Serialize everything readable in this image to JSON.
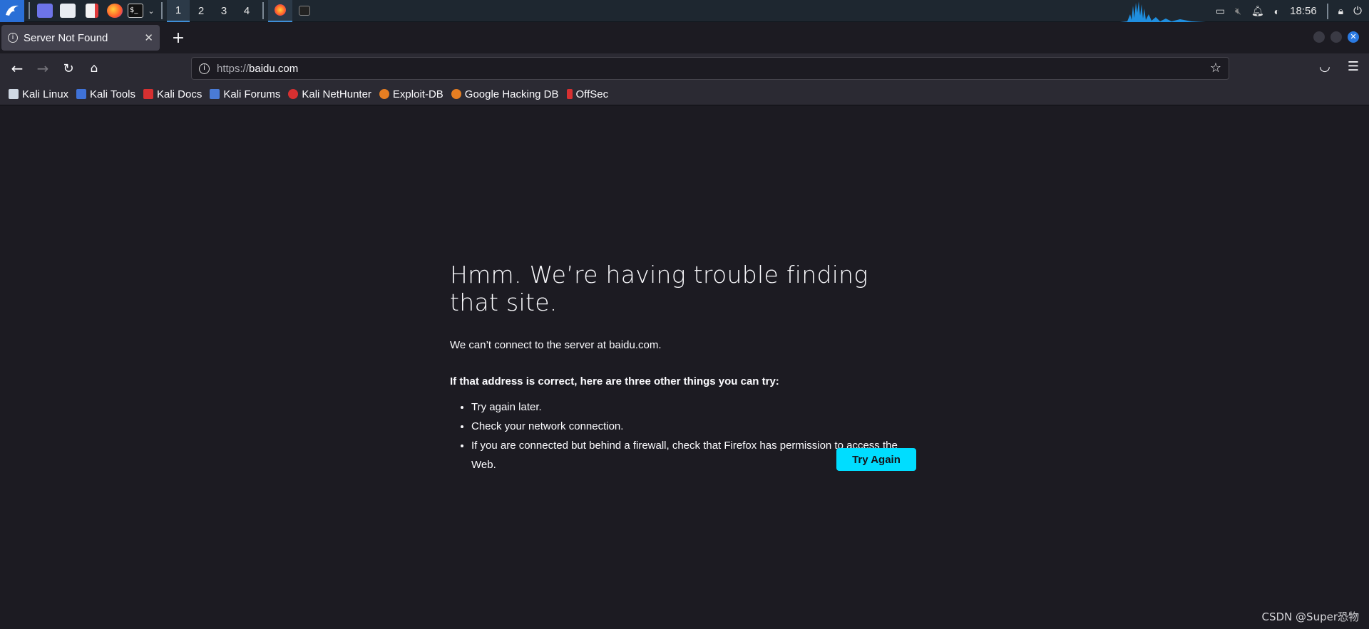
{
  "taskbar": {
    "workspaces": [
      "1",
      "2",
      "3",
      "4"
    ],
    "active_workspace": "1",
    "clock": "18:56"
  },
  "browser": {
    "tab_title": "Server Not Found",
    "url_scheme": "https://",
    "url_host": "baidu.com"
  },
  "bookmarks": [
    {
      "label": "Kali Linux",
      "icon": "kali-dragon-icon",
      "color": "#cfd8e3"
    },
    {
      "label": "Kali Tools",
      "icon": "kali-tools-icon",
      "color": "#3f72d8"
    },
    {
      "label": "Kali Docs",
      "icon": "kali-docs-icon",
      "color": "#d63031"
    },
    {
      "label": "Kali Forums",
      "icon": "kali-forums-icon",
      "color": "#4a7bd6"
    },
    {
      "label": "Kali NetHunter",
      "icon": "nethunter-icon",
      "color": "#d63031"
    },
    {
      "label": "Exploit-DB",
      "icon": "exploit-db-icon",
      "color": "#e67e22"
    },
    {
      "label": "Google Hacking DB",
      "icon": "ghdb-icon",
      "color": "#e67e22"
    },
    {
      "label": "OffSec",
      "icon": "offsec-icon",
      "color": "#d63031"
    }
  ],
  "error": {
    "heading": "Hmm. We’re having trouble finding that site.",
    "message": "We can’t connect to the server at baidu.com.",
    "suggestions_title": "If that address is correct, here are three other things you can try:",
    "suggestions": [
      "Try again later.",
      "Check your network connection.",
      "If you are connected but behind a firewall, check that Firefox has permission to access the Web."
    ],
    "button_label": "Try Again"
  },
  "watermark": "CSDN @Super恐物",
  "colors": {
    "accent": "#00ddff",
    "background": "#1c1b22",
    "toolbar": "#2b2a33"
  }
}
